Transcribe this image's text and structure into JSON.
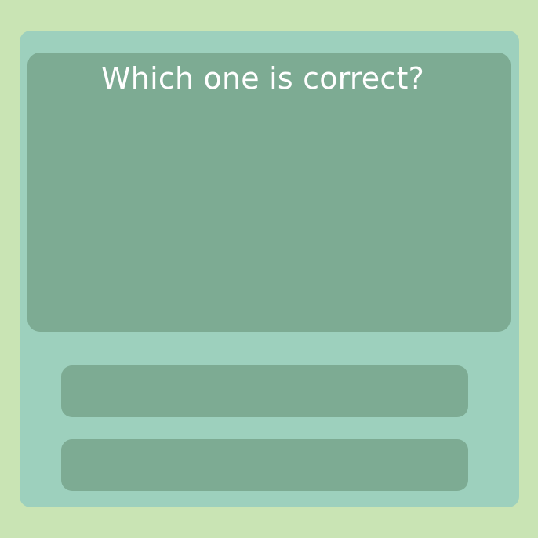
{
  "question": {
    "text": "Which one is correct?"
  },
  "options": [
    {
      "label": ""
    },
    {
      "label": ""
    }
  ],
  "colors": {
    "background": "#c9e4b4",
    "card": "#9dd0bd",
    "panel": "#7dab93",
    "text": "#ffffff"
  }
}
